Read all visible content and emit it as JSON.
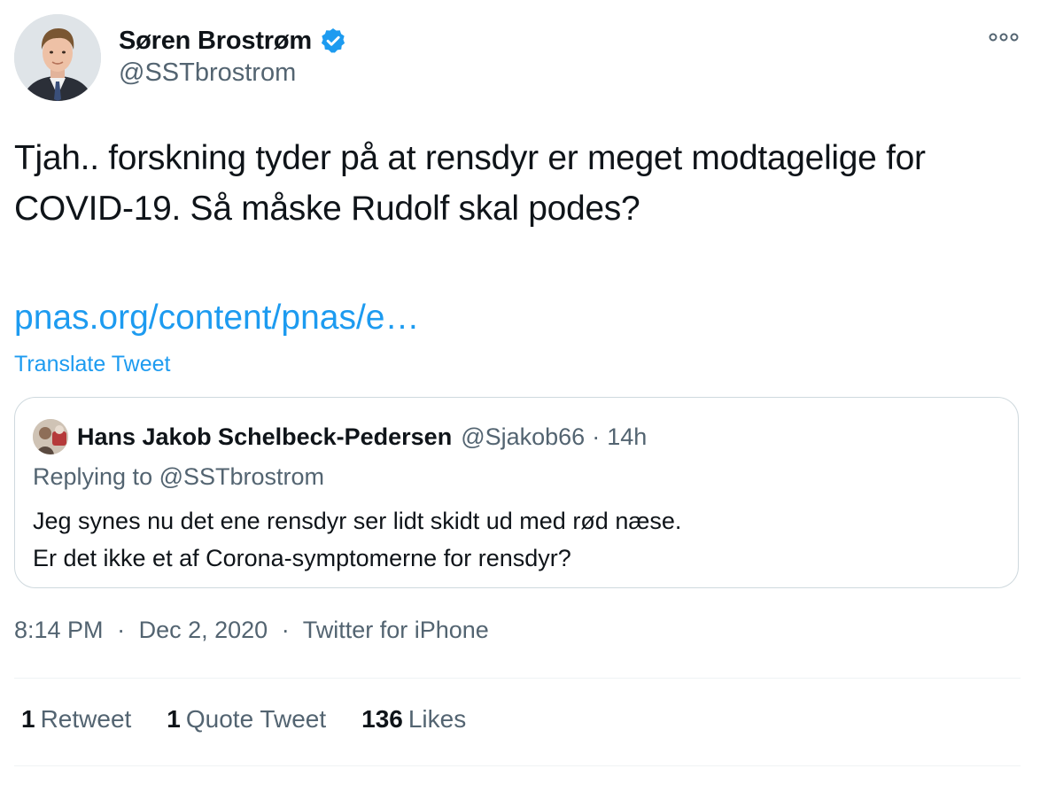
{
  "author": {
    "name": "Søren Brostrøm",
    "handle": "@SSTbrostrom",
    "verified": true,
    "avatar_icon": "user-avatar-photo"
  },
  "tweet": {
    "text": "Tjah.. forskning tyder på at rensdyr er meget modtagelige for COVID-19. Så måske Rudolf skal podes?",
    "link_text": "pnas.org/content/pnas/e…",
    "translate_label": "Translate Tweet"
  },
  "quoted_tweet": {
    "author_name": "Hans Jakob Schelbeck-Pedersen",
    "author_handle": "@Sjakob66",
    "separator": "·",
    "time": "14h",
    "replying_prefix": "Replying to",
    "replying_to": "@SSTbrostrom",
    "body_line1": "Jeg synes nu det ene rensdyr ser lidt skidt ud med rød næse.",
    "body_line2": "Er det ikke et af Corona-symptomerne for rensdyr?"
  },
  "meta": {
    "time": "8:14 PM",
    "separator": "·",
    "date": "Dec 2, 2020",
    "source": "Twitter for iPhone"
  },
  "stats": {
    "retweets_count": "1",
    "retweets_label": "Retweet",
    "quotes_count": "1",
    "quotes_label": "Quote Tweet",
    "likes_count": "136",
    "likes_label": "Likes"
  },
  "colors": {
    "link": "#1d9bf0",
    "secondary_text": "#536471",
    "primary_text": "#0f1419",
    "border": "#cfd9de",
    "verified_badge": "#1d9bf0"
  },
  "icons": {
    "more": "more-horizontal-icon",
    "verified": "verified-badge-icon"
  }
}
